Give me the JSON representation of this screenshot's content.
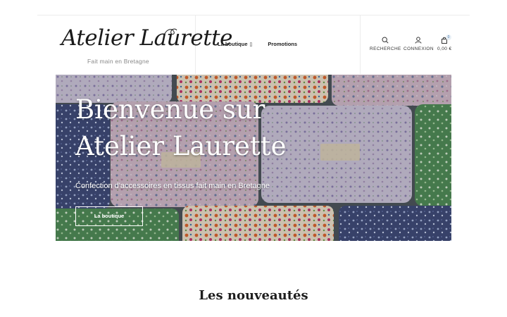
{
  "brand": {
    "name": "Atelier Laurette",
    "tagline": "Fait main en Bretagne"
  },
  "nav": {
    "items": [
      {
        "label": "La boutique",
        "has_dropdown": true
      },
      {
        "label": "Promotions",
        "has_dropdown": false
      }
    ]
  },
  "header_icons": {
    "search_label": "RECHERCHE",
    "account_label": "CONNEXION",
    "cart_label": "0,00 €",
    "cart_count": "0"
  },
  "hero": {
    "title_line1": "Bienvenue sur",
    "title_line2": "Atelier Laurette",
    "subtitle": "Confection d'accessoires en tissus fait main en Bretagne",
    "button_label": "La boutique"
  },
  "section": {
    "title": "Les nouveautés"
  },
  "colors": {
    "accent_badge": "#e9f0f6",
    "text": "#222222",
    "border": "#ececec"
  }
}
